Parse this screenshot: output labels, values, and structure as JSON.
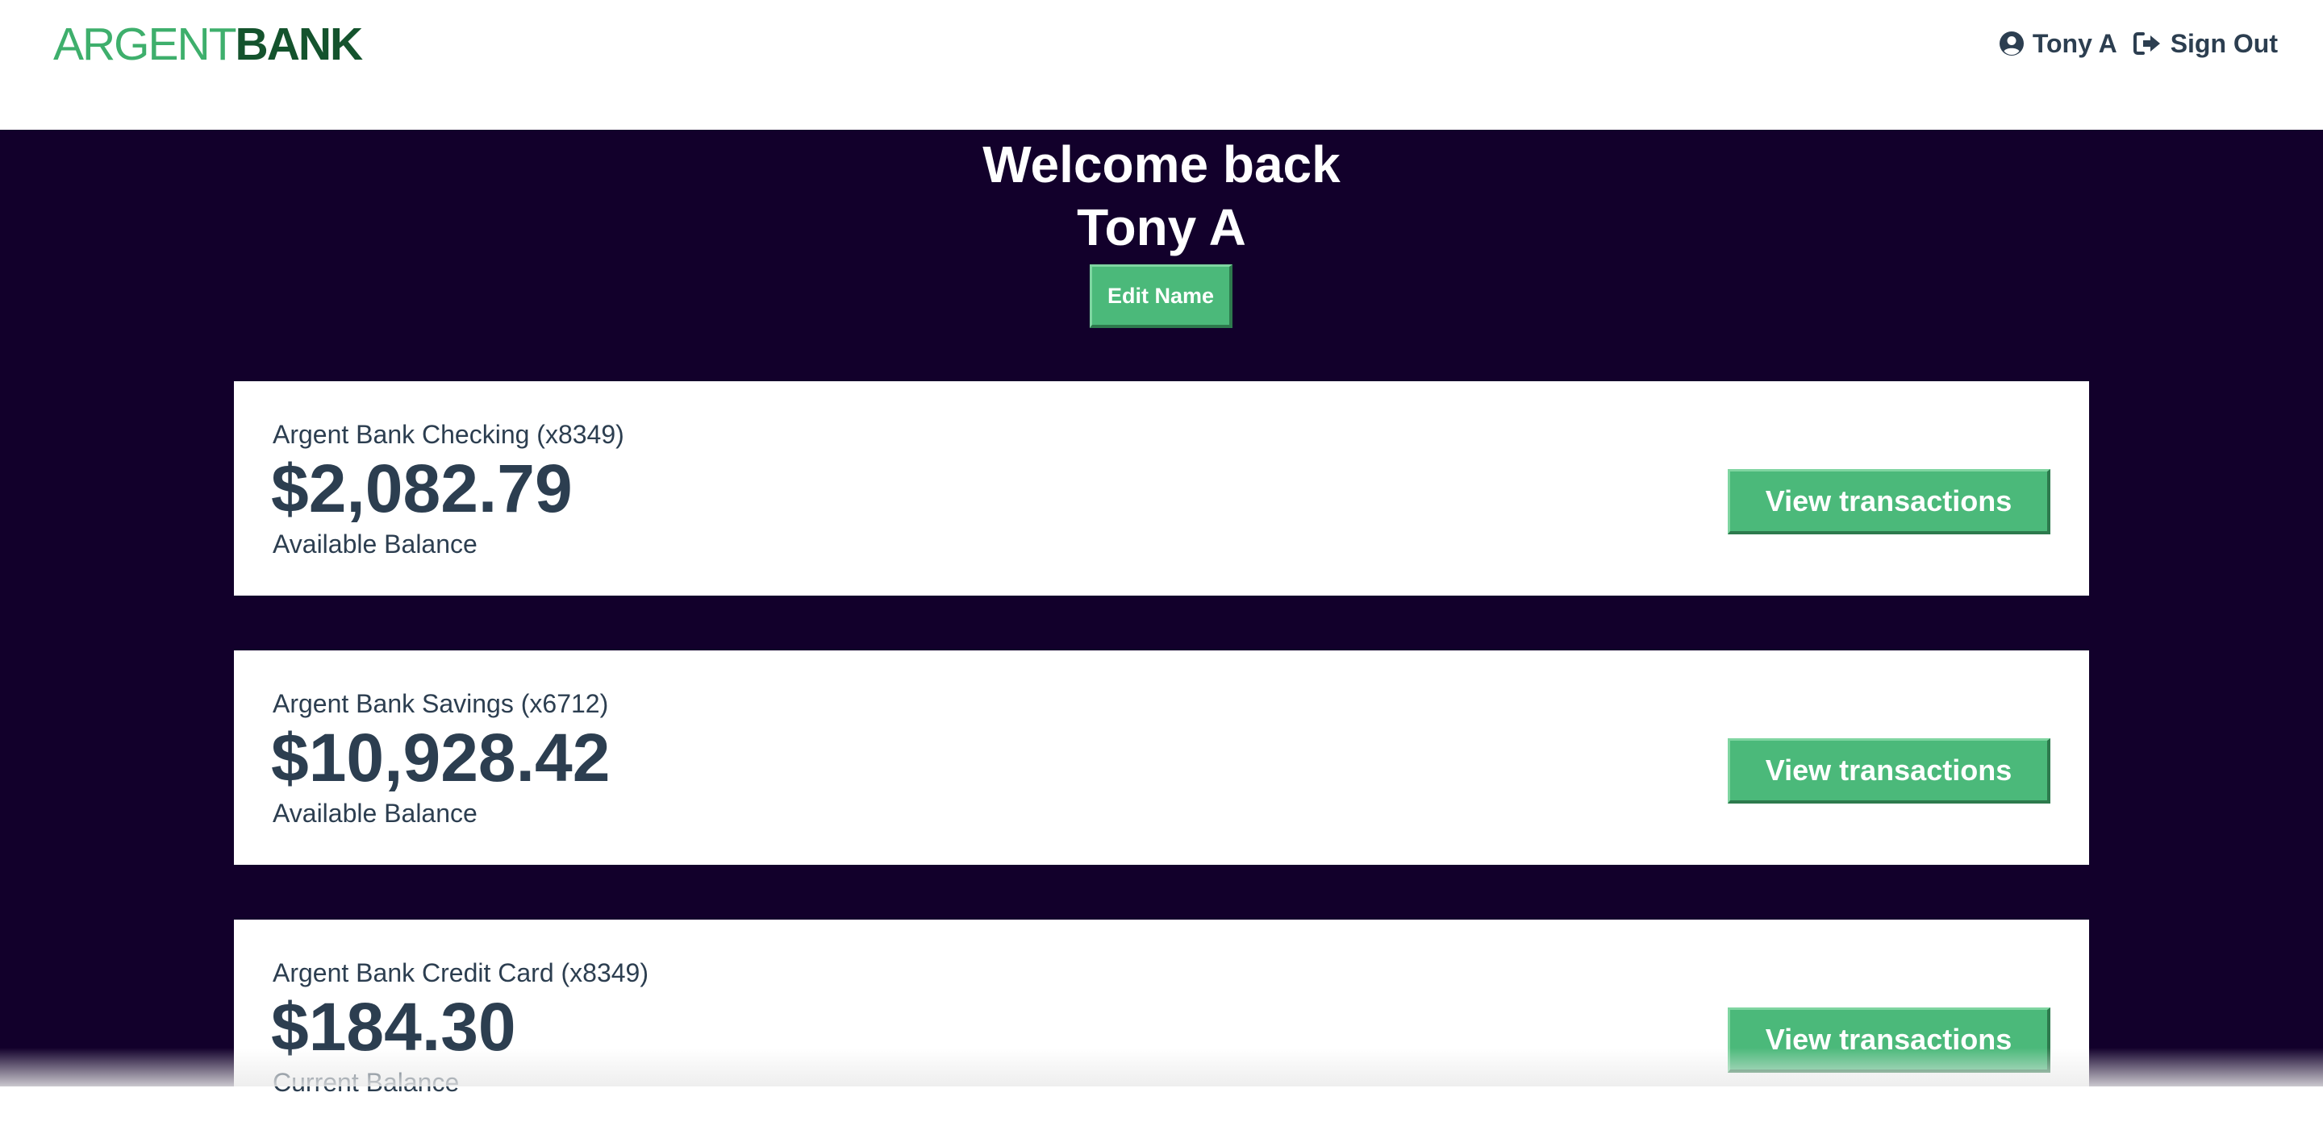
{
  "header": {
    "logo_part1": "ARGENT",
    "logo_part2": "BANK",
    "user_name": "Tony A",
    "sign_out_label": "Sign Out"
  },
  "welcome": {
    "line1": "Welcome back",
    "line2": "Tony A",
    "edit_button_label": "Edit Name"
  },
  "accounts": [
    {
      "title": "Argent Bank Checking (x8349)",
      "amount": "$2,082.79",
      "description": "Available Balance",
      "button_label": "View transactions"
    },
    {
      "title": "Argent Bank Savings (x6712)",
      "amount": "$10,928.42",
      "description": "Available Balance",
      "button_label": "View transactions"
    },
    {
      "title": "Argent Bank Credit Card (x8349)",
      "amount": "$184.30",
      "description": "Current Balance",
      "button_label": "View transactions"
    }
  ],
  "icons": {
    "user": "user-circle-icon",
    "sign_out": "sign-out-icon"
  },
  "colors": {
    "brand_green": "#4bb97a",
    "logo_green_light": "#3eaf6c",
    "logo_green_dark": "#14532d",
    "background_dark": "#12002b",
    "text_dark": "#2c3e50"
  }
}
